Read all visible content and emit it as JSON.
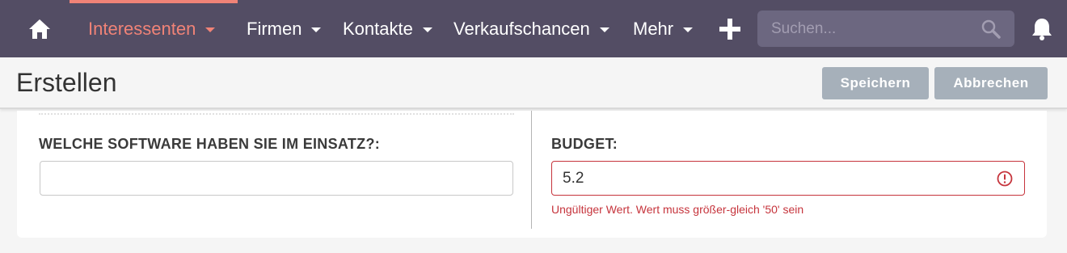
{
  "colors": {
    "nav_bg": "#534d64",
    "nav_active": "#f08377",
    "search_bg": "#6c6780",
    "button_bg": "#a6b0ba",
    "error": "#c6343c"
  },
  "nav": {
    "home_icon": "home-icon",
    "items": [
      {
        "label": "Interessenten",
        "active": true
      },
      {
        "label": "Firmen",
        "active": false
      },
      {
        "label": "Kontakte",
        "active": false
      },
      {
        "label": "Verkaufschancen",
        "active": false
      },
      {
        "label": "Mehr",
        "active": false
      }
    ],
    "create_icon": "plus-icon",
    "search": {
      "placeholder": "Suchen...",
      "value": "",
      "icon": "search-icon"
    },
    "notifications_icon": "bell-icon"
  },
  "header": {
    "title": "Erstellen",
    "save_label": "Speichern",
    "cancel_label": "Abbrechen"
  },
  "form": {
    "software": {
      "label": "WELCHE SOFTWARE HABEN SIE IM EINSATZ?:",
      "value": ""
    },
    "budget": {
      "label": "BUDGET:",
      "value": "5.2",
      "error_icon": "alert-circle-icon",
      "error": "Ungültiger Wert. Wert muss größer-gleich '50' sein"
    }
  }
}
